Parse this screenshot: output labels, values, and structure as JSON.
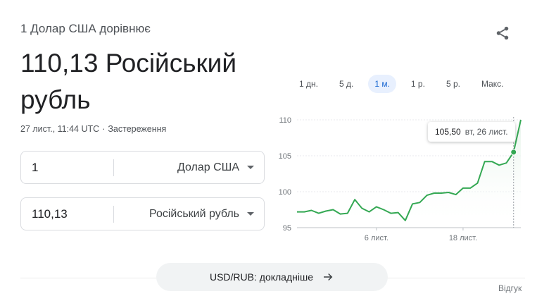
{
  "header": {
    "equals_label": "1 Долар США дорівнює",
    "rate_value": "110,13 Російський рубль",
    "timestamp": "27 лист., 11:44 UTC",
    "disclaimer": "Застереження",
    "share_icon": "share-icon"
  },
  "converter": {
    "from": {
      "amount": "1",
      "currency": "Долар США"
    },
    "to": {
      "amount": "110,13",
      "currency": "Російський рубль"
    }
  },
  "range_tabs": [
    {
      "label": "1 дн.",
      "active": false
    },
    {
      "label": "5 д.",
      "active": false
    },
    {
      "label": "1 м.",
      "active": true
    },
    {
      "label": "1 р.",
      "active": false
    },
    {
      "label": "5 р.",
      "active": false
    },
    {
      "label": "Макс.",
      "active": false
    }
  ],
  "tooltip": {
    "value": "105,50",
    "date": "вт, 26 лист."
  },
  "details_button": {
    "label": "USD/RUB: докладніше"
  },
  "feedback": {
    "label": "Відгук"
  },
  "colors": {
    "line": "#34a853",
    "area": "#e6f4ea",
    "active_tab_bg": "#e8f0fe",
    "active_tab_text": "#1967d2"
  },
  "chart_data": {
    "type": "area",
    "y_ticks": [
      "110",
      "105",
      "100",
      "95"
    ],
    "ylim": [
      95,
      110
    ],
    "x_ticks": [
      {
        "label": "6 лист.",
        "index": 11
      },
      {
        "label": "18 лист.",
        "index": 23
      }
    ],
    "values": [
      97.2,
      97.2,
      97.4,
      97.0,
      97.3,
      97.5,
      96.9,
      97.0,
      98.9,
      97.7,
      97.2,
      97.9,
      97.5,
      97.0,
      97.1,
      96.0,
      98.3,
      98.5,
      99.5,
      99.8,
      99.8,
      99.9,
      99.6,
      100.5,
      100.5,
      101.2,
      104.2,
      104.2,
      103.7,
      104.0,
      105.5,
      110.0
    ],
    "hover_index": 30
  }
}
